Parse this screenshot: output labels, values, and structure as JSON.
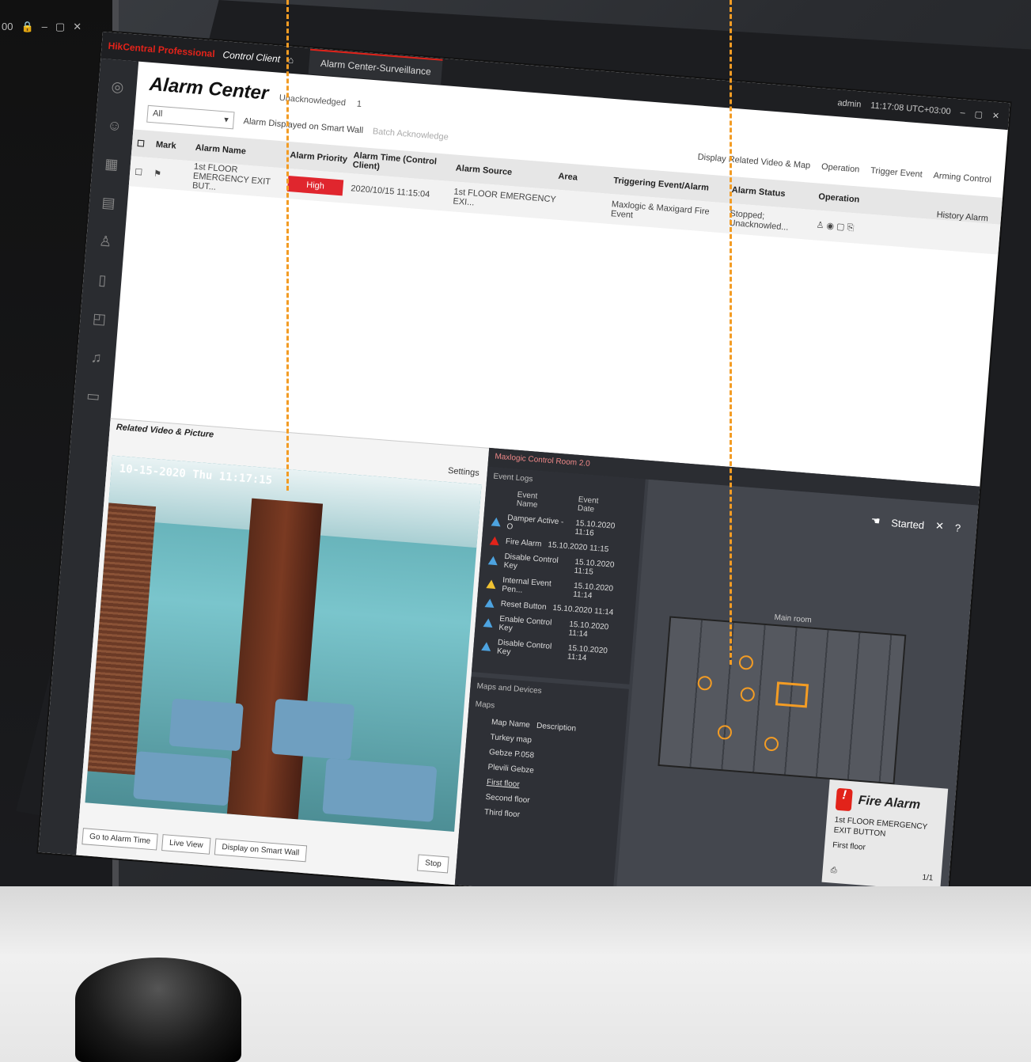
{
  "bg_window": {
    "time": "00",
    "controls": [
      "🔒",
      "–",
      "▢",
      "✕"
    ]
  },
  "titlebar": {
    "logo": "HikCentral Professional",
    "app": "Control Client",
    "tab": "Alarm Center-Surveillance",
    "status": "admin",
    "time": "11:17:08 UTC+03:00"
  },
  "header": {
    "title": "Alarm Center",
    "unack_label": "Unacknowledged",
    "unack_count": "1"
  },
  "toolbar": {
    "filter_value": "All",
    "smartwall": "Alarm Displayed on Smart Wall",
    "ack": "Batch Acknowledge",
    "display_related": "Display Related Video & Map",
    "operation": "Operation",
    "trigger": "Trigger Event",
    "arming": "Arming Control"
  },
  "history": "History Alarm",
  "table": {
    "headers": [
      "Mark",
      "Alarm Name",
      "Alarm Priority",
      "Alarm Time (Control Client)",
      "Alarm Source",
      "Area",
      "Triggering Event/Alarm",
      "Alarm Status",
      "Operation"
    ],
    "row": {
      "name": "1st FLOOR EMERGENCY EXIT BUT...",
      "priority": "High",
      "time": "2020/10/15 11:15:04",
      "source": "1st FLOOR EMERGENCY EXI...",
      "area": "",
      "trigger": "Maxlogic & Maxigard Fire Event",
      "status": "Stopped; Unacknowled..."
    }
  },
  "video": {
    "panel_title": "Related Video & Picture",
    "settings": "Settings",
    "timestamp": "10-15-2020 Thu 11:17:15",
    "buttons": [
      "Go to Alarm Time",
      "Live View",
      "Display on Smart Wall"
    ],
    "stop": "Stop"
  },
  "map": {
    "header": "Maxlogic Control Room 2.0",
    "eventlogs_title": "Event Logs",
    "cols": [
      "Event Name",
      "Event Date"
    ],
    "events": [
      {
        "name": "Damper Active - O",
        "date": "15.10.2020 11:16",
        "color": "blue"
      },
      {
        "name": "Fire Alarm",
        "date": "15.10.2020 11:15",
        "color": "red"
      },
      {
        "name": "Disable Control Key",
        "date": "15.10.2020 11:15",
        "color": "blue"
      },
      {
        "name": "Internal Event Pen...",
        "date": "15.10.2020 11:14",
        "color": "yellow"
      },
      {
        "name": "Reset Button",
        "date": "15.10.2020 11:14",
        "color": "blue"
      },
      {
        "name": "Enable Control Key",
        "date": "15.10.2020 11:14",
        "color": "blue"
      },
      {
        "name": "Disable Control Key",
        "date": "15.10.2020 11:14",
        "color": "blue"
      }
    ],
    "maps_title": "Maps and Devices",
    "maps_label": "Maps",
    "maps_cols": [
      "Map Name",
      "Description"
    ],
    "maps": [
      "Turkey map",
      "Gebze P.058",
      "Plevili Gebze",
      "First floor",
      "Second floor",
      "Third floor"
    ],
    "started": "Started",
    "floor_label": "Main room",
    "alarm_popup": {
      "title": "Fire Alarm",
      "desc": "1st FLOOR EMERGENCY EXIT BUTTON",
      "floor": "First floor",
      "page": "1/1"
    }
  }
}
